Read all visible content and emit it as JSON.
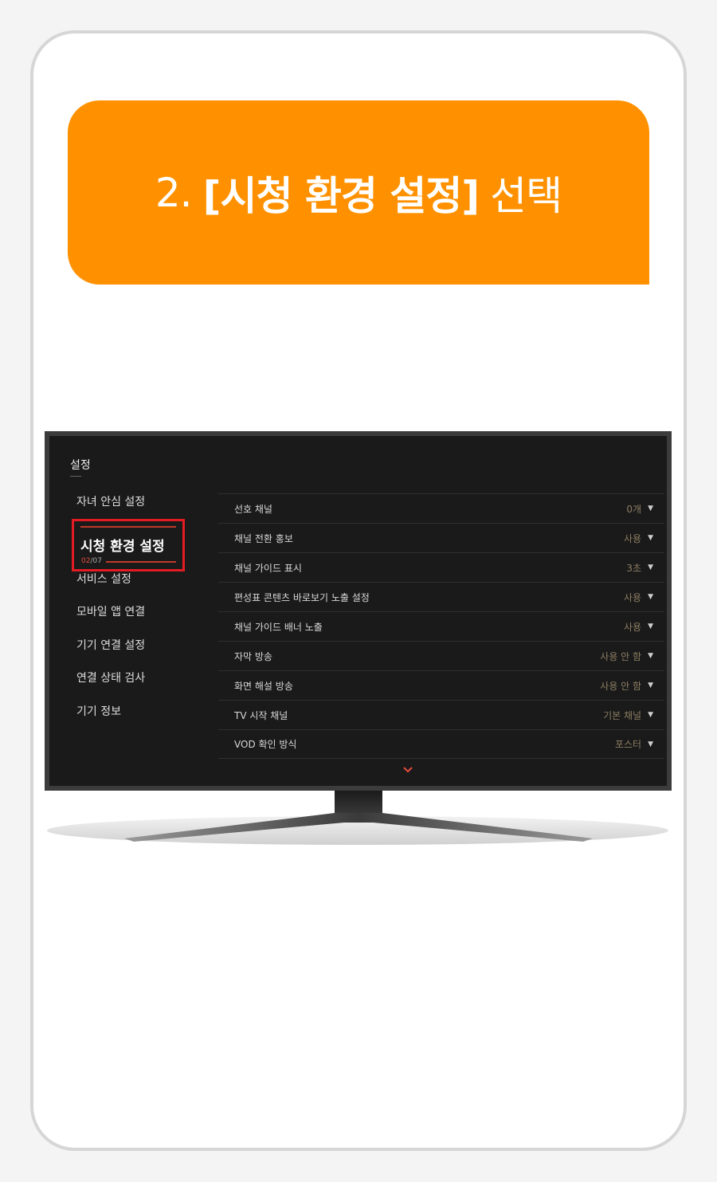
{
  "banner": {
    "step": "2.",
    "highlight": "[시청 환경 설정]",
    "action": "선택",
    "color": "#ff9100"
  },
  "tv": {
    "title": "설정",
    "sidebar": {
      "items": [
        {
          "label": "자녀 안심 설정"
        },
        {
          "label": "시청 환경 설정",
          "active": true,
          "page_current": "02",
          "page_total": "07"
        },
        {
          "label": "서비스 설정"
        },
        {
          "label": "모바일 앱 연결"
        },
        {
          "label": "기기 연결 설정"
        },
        {
          "label": "연결 상태 검사"
        },
        {
          "label": "기기 정보"
        }
      ]
    },
    "rows": [
      {
        "label": "선호 채널",
        "value": "0개"
      },
      {
        "label": "채널 전환 홍보",
        "value": "사용"
      },
      {
        "label": "채널 가이드 표시",
        "value": "3초"
      },
      {
        "label": "편성표 콘텐츠 바로보기 노출 설정",
        "value": "사용"
      },
      {
        "label": "채널 가이드 배너 노출",
        "value": "사용"
      },
      {
        "label": "자막 방송",
        "value": "사용 안 함"
      },
      {
        "label": "화면 해설 방송",
        "value": "사용 안 함"
      },
      {
        "label": "TV 시작 채널",
        "value": "기본 채널"
      },
      {
        "label": "VOD 확인 방식",
        "value": "포스터"
      }
    ],
    "highlight_color": "#e31c23"
  },
  "icons": {
    "dropdown": "triangle-down-icon",
    "scroll_more": "chevron-down-icon"
  }
}
